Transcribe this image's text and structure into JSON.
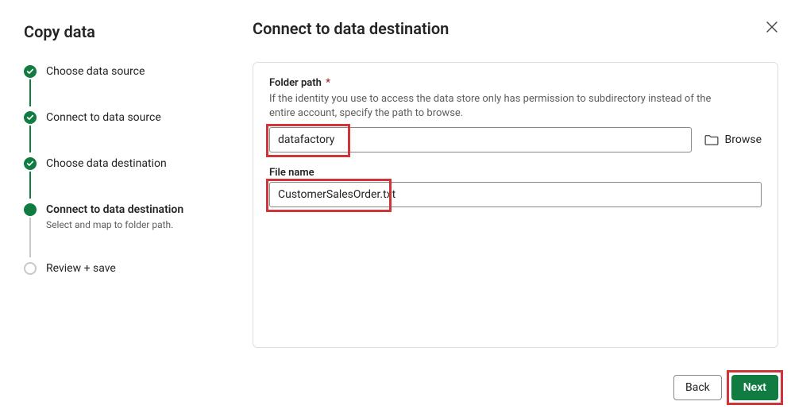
{
  "sidebar": {
    "title": "Copy data",
    "steps": [
      {
        "label": "Choose data source",
        "state": "done"
      },
      {
        "label": "Connect to data source",
        "state": "done"
      },
      {
        "label": "Choose data destination",
        "state": "done"
      },
      {
        "label": "Connect to data destination",
        "state": "current",
        "sub": "Select and map to folder path."
      },
      {
        "label": "Review + save",
        "state": "open"
      }
    ]
  },
  "main": {
    "title": "Connect to data destination"
  },
  "form": {
    "folder": {
      "label": "Folder path",
      "required_marker": "*",
      "description": "If the identity you use to access the data store only has permission to subdirectory instead of the entire account, specify the path to browse.",
      "value": "datafactory",
      "browse_label": "Browse"
    },
    "file": {
      "label": "File name",
      "value": "CustomerSalesOrder.txt"
    }
  },
  "footer": {
    "back": "Back",
    "next": "Next"
  }
}
